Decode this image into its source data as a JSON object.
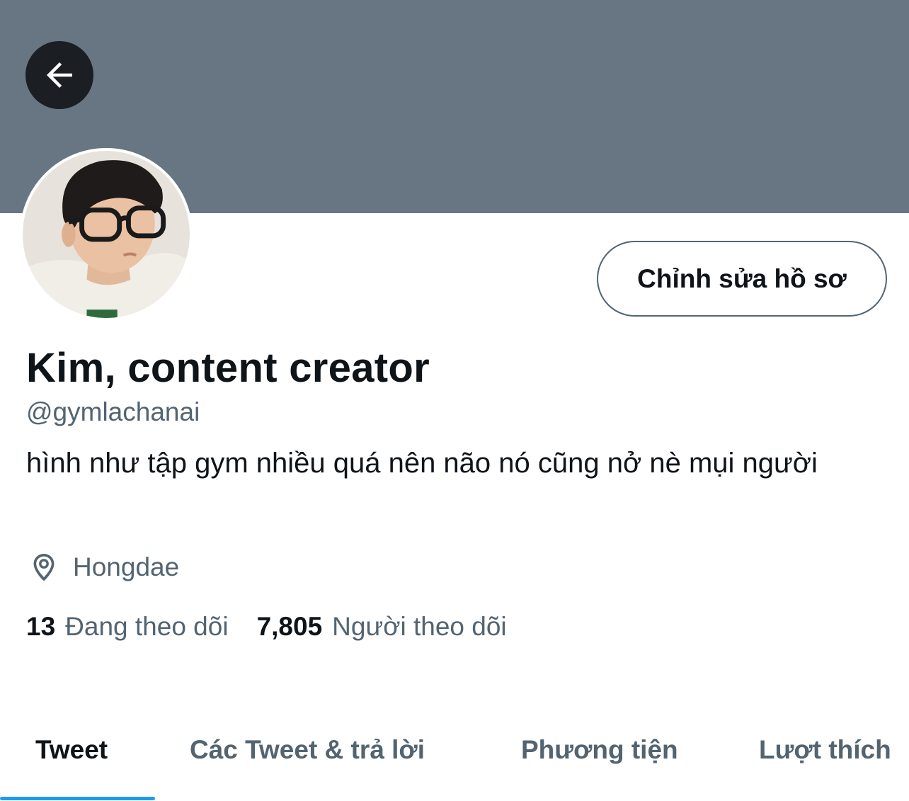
{
  "header": {
    "banner_color": "#687684",
    "back_icon": "arrow-left-icon"
  },
  "profile": {
    "avatar_icon": "profile-photo",
    "edit_button_label": "Chỉnh sửa hồ sơ",
    "display_name": "Kim, content creator",
    "handle": "@gymlachanai",
    "bio": "hình như tập gym nhiều quá nên não nó cũng nở nè mụi người",
    "location_icon": "location-pin-icon",
    "location": "Hongdae",
    "following_count": "13",
    "following_label": "Đang theo dõi",
    "followers_count": "7,805",
    "followers_label": "Người theo dõi"
  },
  "tabs": [
    {
      "label": "Tweet",
      "active": true
    },
    {
      "label": "Các Tweet & trả lời",
      "active": false
    },
    {
      "label": "Phương tiện",
      "active": false
    },
    {
      "label": "Lượt thích",
      "active": false
    }
  ],
  "colors": {
    "accent": "#1d9bf0",
    "text_primary": "#0f1419",
    "text_secondary": "#536471"
  }
}
